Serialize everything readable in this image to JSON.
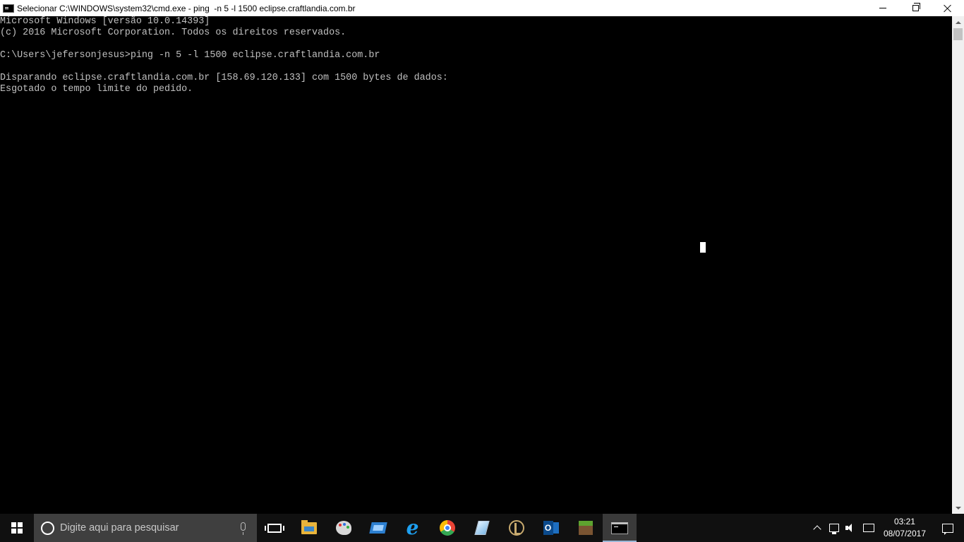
{
  "window": {
    "title": "Selecionar C:\\WINDOWS\\system32\\cmd.exe - ping  -n 5 -l 1500 eclipse.craftlandia.com.br",
    "icon": "cmd-icon"
  },
  "console": {
    "lines": [
      "Microsoft Windows [versão 10.0.14393]",
      "(c) 2016 Microsoft Corporation. Todos os direitos reservados.",
      "",
      "C:\\Users\\jefersonjesus>ping -n 5 -l 1500 eclipse.craftlandia.com.br",
      "",
      "Disparando eclipse.craftlandia.com.br [158.69.120.133] com 1500 bytes de dados:",
      "Esgotado o tempo limite do pedido."
    ],
    "text_color": "#c0c0c0",
    "background": "#000000"
  },
  "taskbar": {
    "search": {
      "placeholder": "Digite aqui para pesquisar"
    },
    "apps": [
      {
        "name": "task-view",
        "icon": "task-view-icon"
      },
      {
        "name": "file-explorer",
        "icon": "folder-icon"
      },
      {
        "name": "paint",
        "icon": "paint-icon"
      },
      {
        "name": "remote-desktop",
        "icon": "remote-desktop-icon"
      },
      {
        "name": "internet-explorer",
        "icon": "internet-explorer-icon"
      },
      {
        "name": "chrome",
        "icon": "chrome-icon"
      },
      {
        "name": "notes",
        "icon": "notes-icon"
      },
      {
        "name": "league-of-legends",
        "icon": "league-icon"
      },
      {
        "name": "outlook",
        "icon": "outlook-icon"
      },
      {
        "name": "minecraft",
        "icon": "minecraft-icon"
      },
      {
        "name": "command-prompt",
        "icon": "cmd-icon",
        "active": true
      }
    ],
    "tray": {
      "time": "03:21",
      "date": "08/07/2017"
    }
  }
}
